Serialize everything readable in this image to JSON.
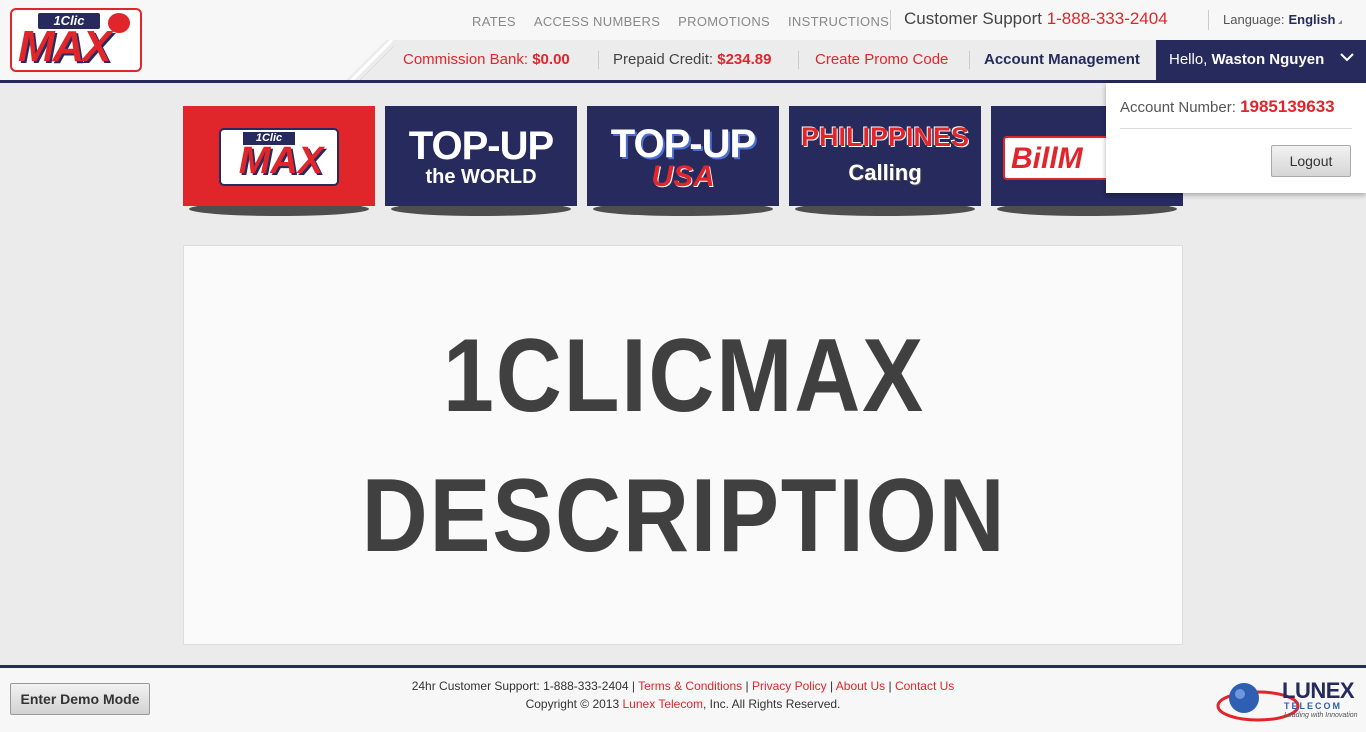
{
  "header": {
    "logo": {
      "top": "1Clic",
      "main": "MAX"
    },
    "nav": [
      "RATES",
      "ACCESS NUMBERS",
      "PROMOTIONS",
      "INSTRUCTIONS"
    ],
    "support_label": "Customer Support",
    "support_phone": "1-888-333-2404",
    "language_label": "Language:",
    "language_value": "English"
  },
  "subnav": {
    "commission_label": "Commission Bank:",
    "commission_value": "$0.00",
    "prepaid_label": "Prepaid Credit:",
    "prepaid_value": "$234.89",
    "promo_label": "Create Promo Code",
    "account_label": "Account Management",
    "hello_label": "Hello,",
    "user_name": "Waston Nguyen"
  },
  "dropdown": {
    "account_label": "Account Number:",
    "account_number": "1985139633",
    "logout_label": "Logout"
  },
  "products": [
    {
      "name": "1clicmax",
      "line1": "1Clic",
      "line2": "MAX",
      "bg": "#e0262b"
    },
    {
      "name": "topup-world",
      "line1": "TOP-UP",
      "line2": "the WORLD",
      "bg": "#262a5c"
    },
    {
      "name": "topup-usa",
      "line1": "TOP-UP",
      "line2": "USA",
      "bg": "#262a5c"
    },
    {
      "name": "philippines-calling",
      "line1": "PHILIPPINES",
      "line2": "Calling",
      "bg": "#262a5c"
    },
    {
      "name": "billmax",
      "line1": "BillM",
      "line2": "",
      "bg": "#262a5c"
    }
  ],
  "panel": {
    "line1": "1CLICMAX",
    "line2": "DESCRIPTION"
  },
  "footer": {
    "demo_label": "Enter Demo Mode",
    "support_text": "24hr Customer Support: 1-888-333-2404 |",
    "terms": "Terms & Conditions",
    "sep": "|",
    "privacy": "Privacy Policy",
    "about": "About Us",
    "contact": "Contact Us",
    "copyright_pre": "Copyright © 2013",
    "copyright_link": "Lunex Telecom",
    "copyright_post": ", Inc. All Rights Reserved.",
    "lunex_name": "LUNEX",
    "lunex_sub": "TELECOM",
    "lunex_tag": "Leading with Innovation"
  },
  "colors": {
    "brand_red": "#e0262b",
    "brand_navy": "#262a5c"
  }
}
